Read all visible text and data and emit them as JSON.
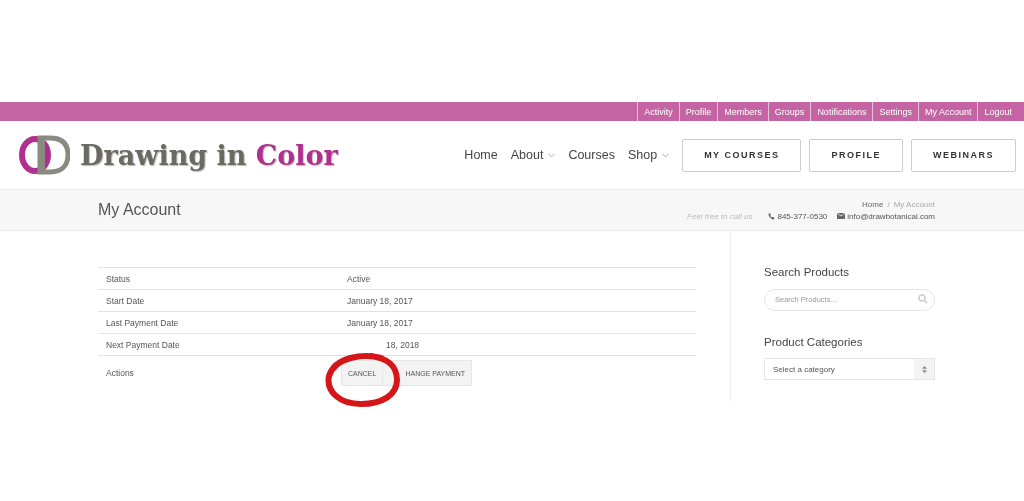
{
  "top_bar": {
    "links": [
      "Activity",
      "Profile",
      "Members",
      "Groups",
      "Notifications",
      "Settings",
      "My Account",
      "Logout"
    ]
  },
  "header": {
    "brand": "Drawing in",
    "brand_accent": "Color",
    "nav": [
      {
        "label": "Home",
        "dropdown": false
      },
      {
        "label": "About",
        "dropdown": true
      },
      {
        "label": "Courses",
        "dropdown": false
      },
      {
        "label": "Shop",
        "dropdown": true
      }
    ],
    "buttons": [
      "MY COURSES",
      "PROFILE",
      "WEBINARS"
    ]
  },
  "title_bar": {
    "title": "My Account",
    "breadcrumb": [
      "Home",
      "My Account"
    ],
    "separator": "/",
    "contact": {
      "note": "Feel free to call us",
      "phone": "845-377-0530",
      "email": "info@drawbotanical.com"
    }
  },
  "subscription": {
    "rows": [
      {
        "label": "Status",
        "value": "Active"
      },
      {
        "label": "Start Date",
        "value": "January 18, 2017"
      },
      {
        "label": "Last Payment Date",
        "value": "January 18, 2017"
      },
      {
        "label": "Next Payment Date",
        "value": "18, 2018"
      }
    ],
    "actions": {
      "label": "Actions",
      "buttons": [
        "CANCEL",
        "HANGE PAYMENT"
      ]
    }
  },
  "sidebar": {
    "search": {
      "heading": "Search Products",
      "placeholder": "Search Products..."
    },
    "categories": {
      "heading": "Product Categories",
      "value": "Select a category"
    }
  }
}
